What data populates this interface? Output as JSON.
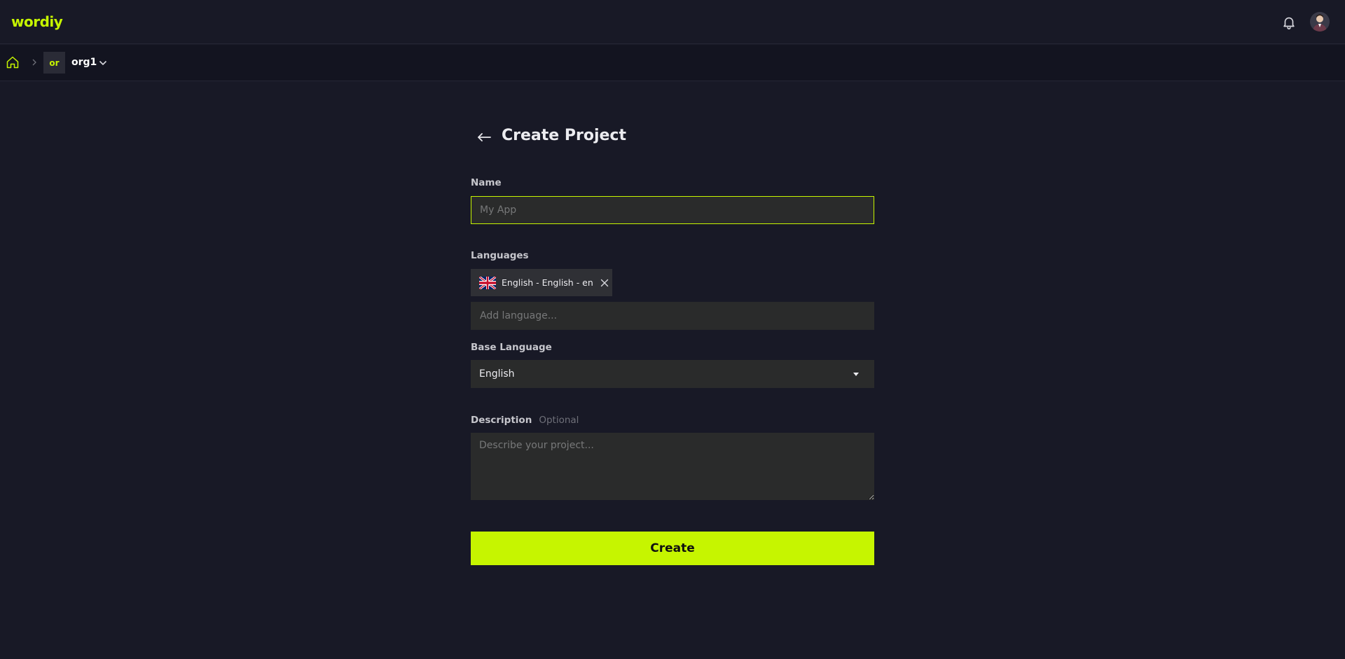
{
  "app": {
    "logo": "wordiy"
  },
  "header": {
    "notifications_icon": "bell-icon",
    "avatar_icon": "user-avatar"
  },
  "breadcrumb": {
    "home_icon": "home-icon",
    "org_badge": "or",
    "org_name": "org1"
  },
  "page": {
    "title": "Create Project"
  },
  "form": {
    "name": {
      "label": "Name",
      "value": "",
      "placeholder": "My App"
    },
    "languages": {
      "label": "Languages",
      "selected": [
        {
          "label": "English - English - en",
          "flag": "uk-flag-icon"
        }
      ],
      "add_placeholder": "Add language..."
    },
    "base_language": {
      "label": "Base Language",
      "value": "English"
    },
    "description": {
      "label": "Description",
      "optional": "Optional",
      "value": "",
      "placeholder": "Describe your project..."
    },
    "submit_label": "Create"
  },
  "colors": {
    "accent": "#c6f500",
    "background": "#181926",
    "input_bg": "#2a2b2b"
  }
}
